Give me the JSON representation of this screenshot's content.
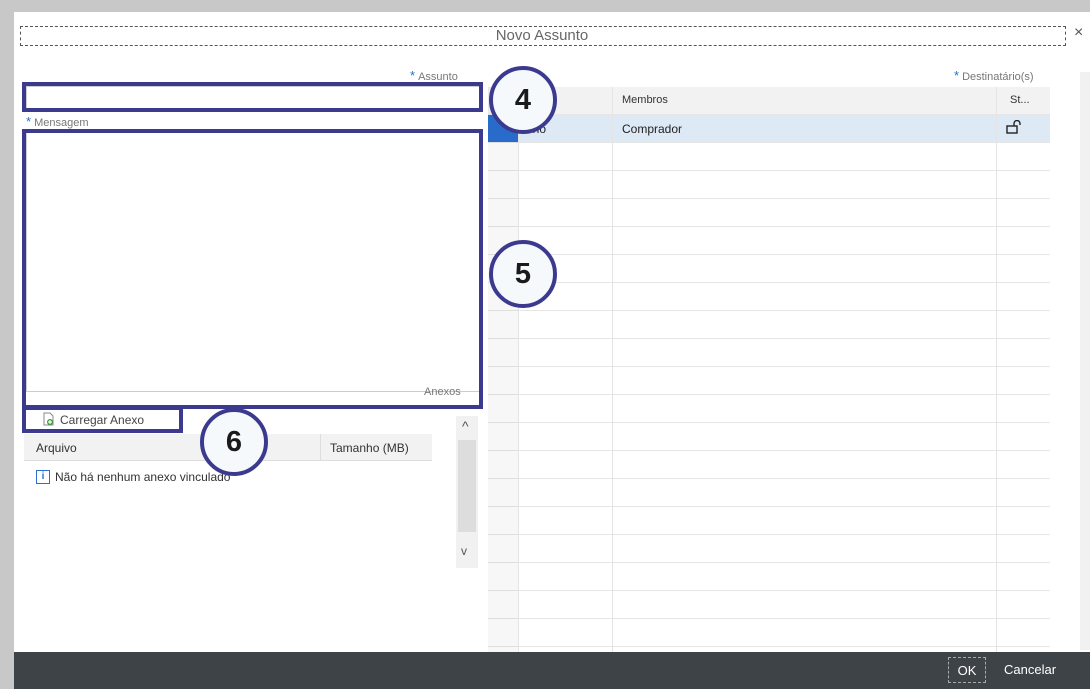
{
  "dialog": {
    "title": "Novo Assunto",
    "close_glyph": "×"
  },
  "subject": {
    "label": "Assunto",
    "required_mark": "*",
    "value": ""
  },
  "message": {
    "label": "Mensagem",
    "required_mark": "*",
    "value": ""
  },
  "attachments": {
    "section_label": "Anexos",
    "upload_button": "Carregar Anexo",
    "columns": [
      "Arquivo",
      "Tamanho (MB)"
    ],
    "empty_message": "Não há nenhum anexo vinculado"
  },
  "recipients": {
    "label": "Destinatário(s)",
    "required_mark": "*",
    "columns": [
      "",
      "Membros",
      "St..."
    ],
    "rows": [
      {
        "type": "erno",
        "member": "Comprador"
      }
    ]
  },
  "callouts": {
    "subject": "4",
    "message": "5",
    "upload": "6"
  },
  "footer": {
    "ok": "OK",
    "cancel": "Cancelar"
  },
  "colors": {
    "highlight": "#3b3a8f",
    "selected_row": "#dde9f5",
    "footer": "#3e4348"
  }
}
